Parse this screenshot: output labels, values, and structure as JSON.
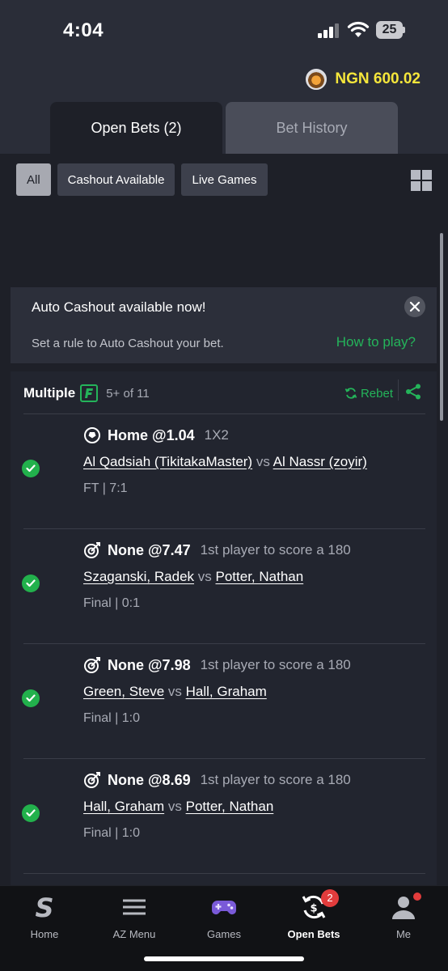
{
  "status": {
    "time": "4:04",
    "battery": "25"
  },
  "balance": {
    "text": "NGN 600.02"
  },
  "tabs": {
    "open_bets": "Open Bets (2)",
    "history": "Bet History"
  },
  "filters": {
    "all": "All",
    "cashout": "Cashout Available",
    "live": "Live Games"
  },
  "banner": {
    "title": "Auto Cashout available now!",
    "subtitle": "Set a rule to Auto Cashout your bet.",
    "link": "How to play?"
  },
  "bet": {
    "type": "Multiple",
    "legs_summary": "5+ of 11",
    "rebet": "Rebet",
    "legs": [
      {
        "selection": "Home @1.04",
        "market": "1X2",
        "home": "Al Qadsiah (TikitakaMaster)",
        "vs": "vs",
        "away": "Al Nassr (zoyir)",
        "result": "FT | 7:1",
        "icon": "soccer-icon"
      },
      {
        "selection": "None @7.47",
        "market": "1st player to score a 180",
        "home": "Szaganski, Radek",
        "vs": "vs",
        "away": "Potter, Nathan",
        "result": "Final | 0:1",
        "icon": "darts-icon"
      },
      {
        "selection": "None @7.98",
        "market": "1st player to score a 180",
        "home": "Green, Steve",
        "vs": "vs",
        "away": "Hall, Graham",
        "result": "Final | 1:0",
        "icon": "darts-icon"
      },
      {
        "selection": "None @8.69",
        "market": "1st player to score a 180",
        "home": "Hall, Graham",
        "vs": "vs",
        "away": "Potter, Nathan",
        "result": "Final | 1:0",
        "icon": "darts-icon"
      }
    ]
  },
  "nav": {
    "home": "Home",
    "az": "AZ Menu",
    "games": "Games",
    "open_bets": "Open Bets",
    "open_bets_badge": "2",
    "me": "Me"
  },
  "colors": {
    "accent_green": "#24b45a",
    "balance_yellow": "#f5e63b",
    "badge_red": "#e23c3c"
  }
}
